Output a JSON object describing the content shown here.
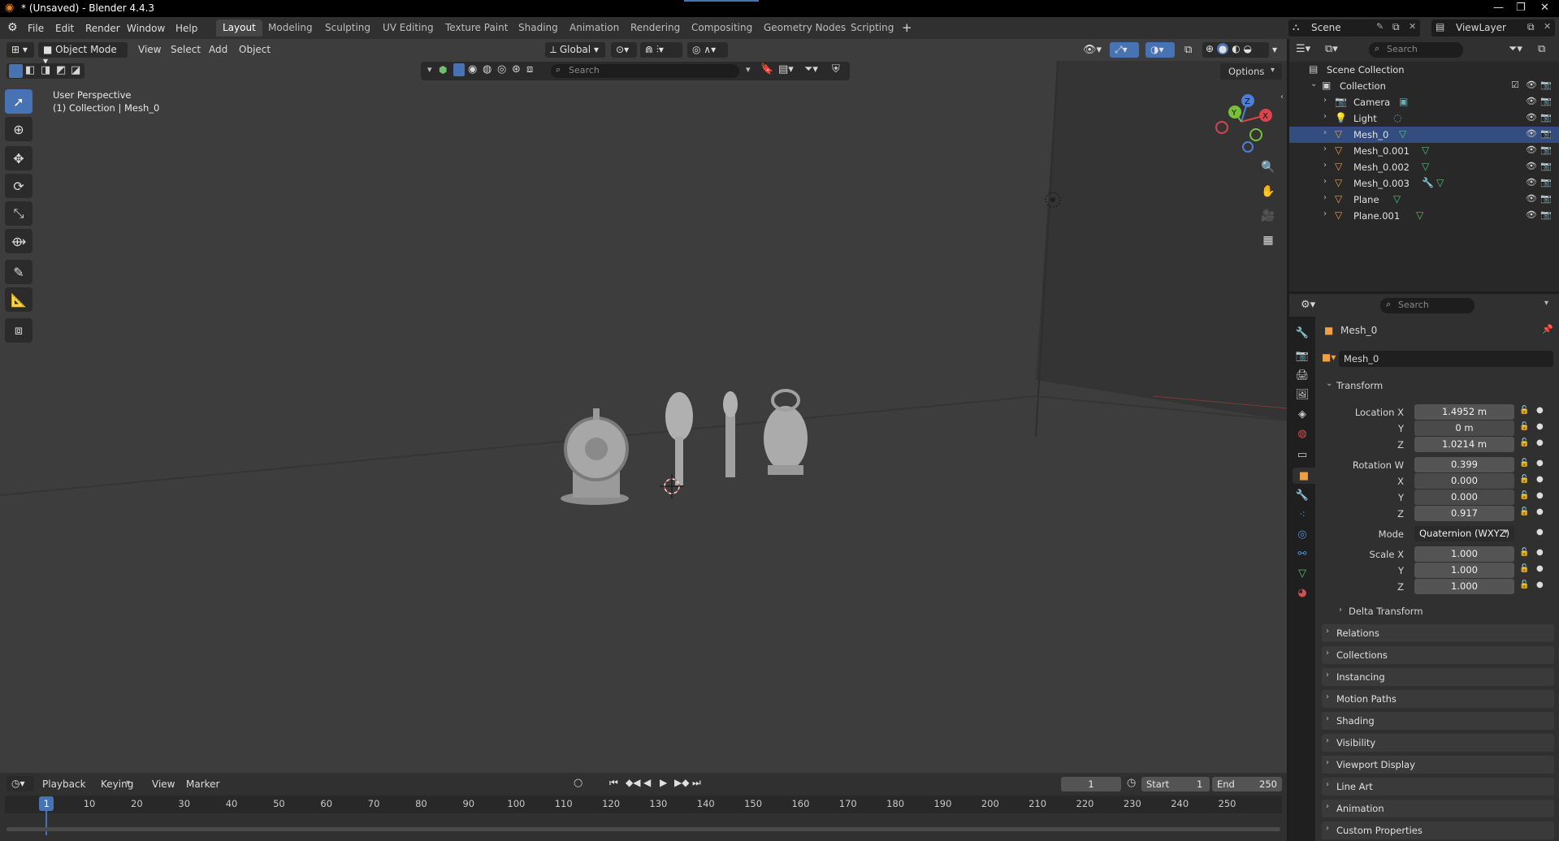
{
  "window": {
    "title": "* (Unsaved) - Blender 4.4.3"
  },
  "menubar": {
    "menus": [
      "File",
      "Edit",
      "Render",
      "Window",
      "Help"
    ],
    "workspaces": [
      "Layout",
      "Modeling",
      "Sculpting",
      "UV Editing",
      "Texture Paint",
      "Shading",
      "Animation",
      "Rendering",
      "Compositing",
      "Geometry Nodes",
      "Scripting"
    ],
    "active_workspace": "Layout",
    "add_tab": "+",
    "scene_label": "Scene",
    "view_layer_label": "ViewLayer"
  },
  "viewport": {
    "mode": "Object Mode",
    "menus": [
      "View",
      "Select",
      "Add",
      "Object"
    ],
    "orientation": "Global",
    "search_placeholder": "Search",
    "options_label": "Options",
    "perspective_text": "User Perspective",
    "collection_text": "(1) Collection | Mesh_0",
    "gizmo_axes": {
      "x": "X",
      "y": "Y",
      "z": "Z"
    }
  },
  "timeline": {
    "menus": [
      "Playback",
      "Keying",
      "View",
      "Marker"
    ],
    "current_frame": "1",
    "start_label": "Start",
    "start_value": "1",
    "end_label": "End",
    "end_value": "250",
    "ticks": [
      "1",
      "10",
      "20",
      "30",
      "40",
      "50",
      "60",
      "70",
      "80",
      "90",
      "100",
      "110",
      "120",
      "130",
      "140",
      "150",
      "160",
      "170",
      "180",
      "190",
      "200",
      "210",
      "220",
      "230",
      "240",
      "250"
    ]
  },
  "outliner": {
    "search_placeholder": "Search",
    "root": "Scene Collection",
    "collection": "Collection",
    "items": [
      {
        "name": "Camera",
        "type": "camera"
      },
      {
        "name": "Light",
        "type": "light"
      },
      {
        "name": "Mesh_0",
        "type": "mesh",
        "selected": true
      },
      {
        "name": "Mesh_0.001",
        "type": "mesh"
      },
      {
        "name": "Mesh_0.002",
        "type": "mesh"
      },
      {
        "name": "Mesh_0.003",
        "type": "mesh"
      },
      {
        "name": "Plane",
        "type": "mesh"
      },
      {
        "name": "Plane.001",
        "type": "mesh"
      }
    ]
  },
  "properties": {
    "search_placeholder": "Search",
    "object_name": "Mesh_0",
    "datablock_name": "Mesh_0",
    "transform": {
      "header": "Transform",
      "location_label": "Location X",
      "location": [
        "1.4952 m",
        "0 m",
        "1.0214 m"
      ],
      "rotation_label": "Rotation W",
      "rotation": [
        "0.399",
        "0.000",
        "0.000",
        "0.917"
      ],
      "mode_label": "Mode",
      "mode_value": "Quaternion (WXYZ)",
      "scale_label": "Scale X",
      "scale": [
        "1.000",
        "1.000",
        "1.000"
      ],
      "axis_y": "Y",
      "axis_z": "Z",
      "axis_x": "X",
      "delta": "Delta Transform"
    },
    "panels": [
      "Relations",
      "Collections",
      "Instancing",
      "Motion Paths",
      "Shading",
      "Visibility",
      "Viewport Display",
      "Line Art",
      "Animation",
      "Custom Properties"
    ]
  },
  "colors": {
    "accent": "#4772b3",
    "selection": "#334d80",
    "viewport_bg": "#3d3d3d"
  }
}
